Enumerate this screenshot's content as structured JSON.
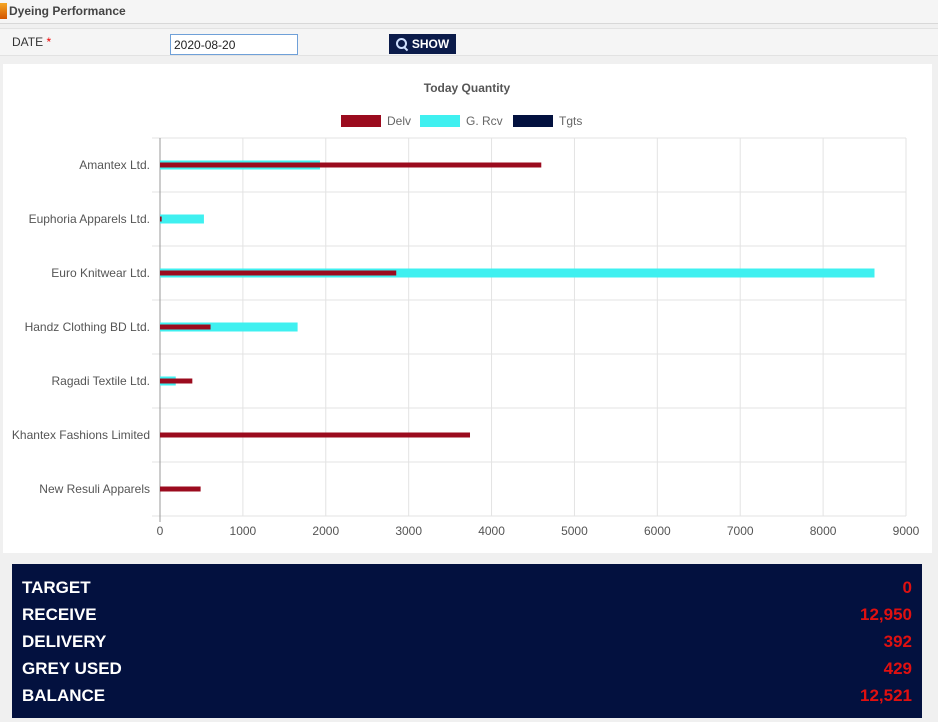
{
  "header": {
    "title": "Dyeing Performance"
  },
  "filter": {
    "date_label": "DATE",
    "required_mark": "*",
    "date_value": "2020-08-20",
    "show_label": "SHOW"
  },
  "chart_data": {
    "type": "bar",
    "orientation": "horizontal",
    "title": "Today Quantity",
    "xlim": [
      0,
      9000
    ],
    "x_ticks": [
      0,
      1000,
      2000,
      3000,
      4000,
      5000,
      6000,
      7000,
      8000,
      9000
    ],
    "grid": true,
    "legend_position": "top",
    "categories": [
      "Amantex Ltd.",
      "Euphoria Apparels Ltd.",
      "Euro Knitwear Ltd.",
      "Handz Clothing BD Ltd.",
      "Ragadi Textile Ltd.",
      "Khantex Fashions Limited",
      "New Resuli Apparels"
    ],
    "series": [
      {
        "name": "Delv",
        "color": "#9b0b1e",
        "values": [
          4600,
          20,
          2850,
          610,
          390,
          3740,
          490
        ]
      },
      {
        "name": "G. Rcv",
        "color": "#3ff0f0",
        "values": [
          1930,
          530,
          8620,
          1660,
          190,
          0,
          0
        ]
      },
      {
        "name": "Tgts",
        "color": "#03113f",
        "values": [
          0,
          0,
          0,
          0,
          0,
          0,
          0
        ]
      }
    ]
  },
  "summary": [
    {
      "label": "TARGET",
      "value": "0"
    },
    {
      "label": "RECEIVE",
      "value": "12,950"
    },
    {
      "label": "DELIVERY",
      "value": "392"
    },
    {
      "label": "GREY USED",
      "value": "429"
    },
    {
      "label": "BALANCE",
      "value": "12,521"
    }
  ]
}
